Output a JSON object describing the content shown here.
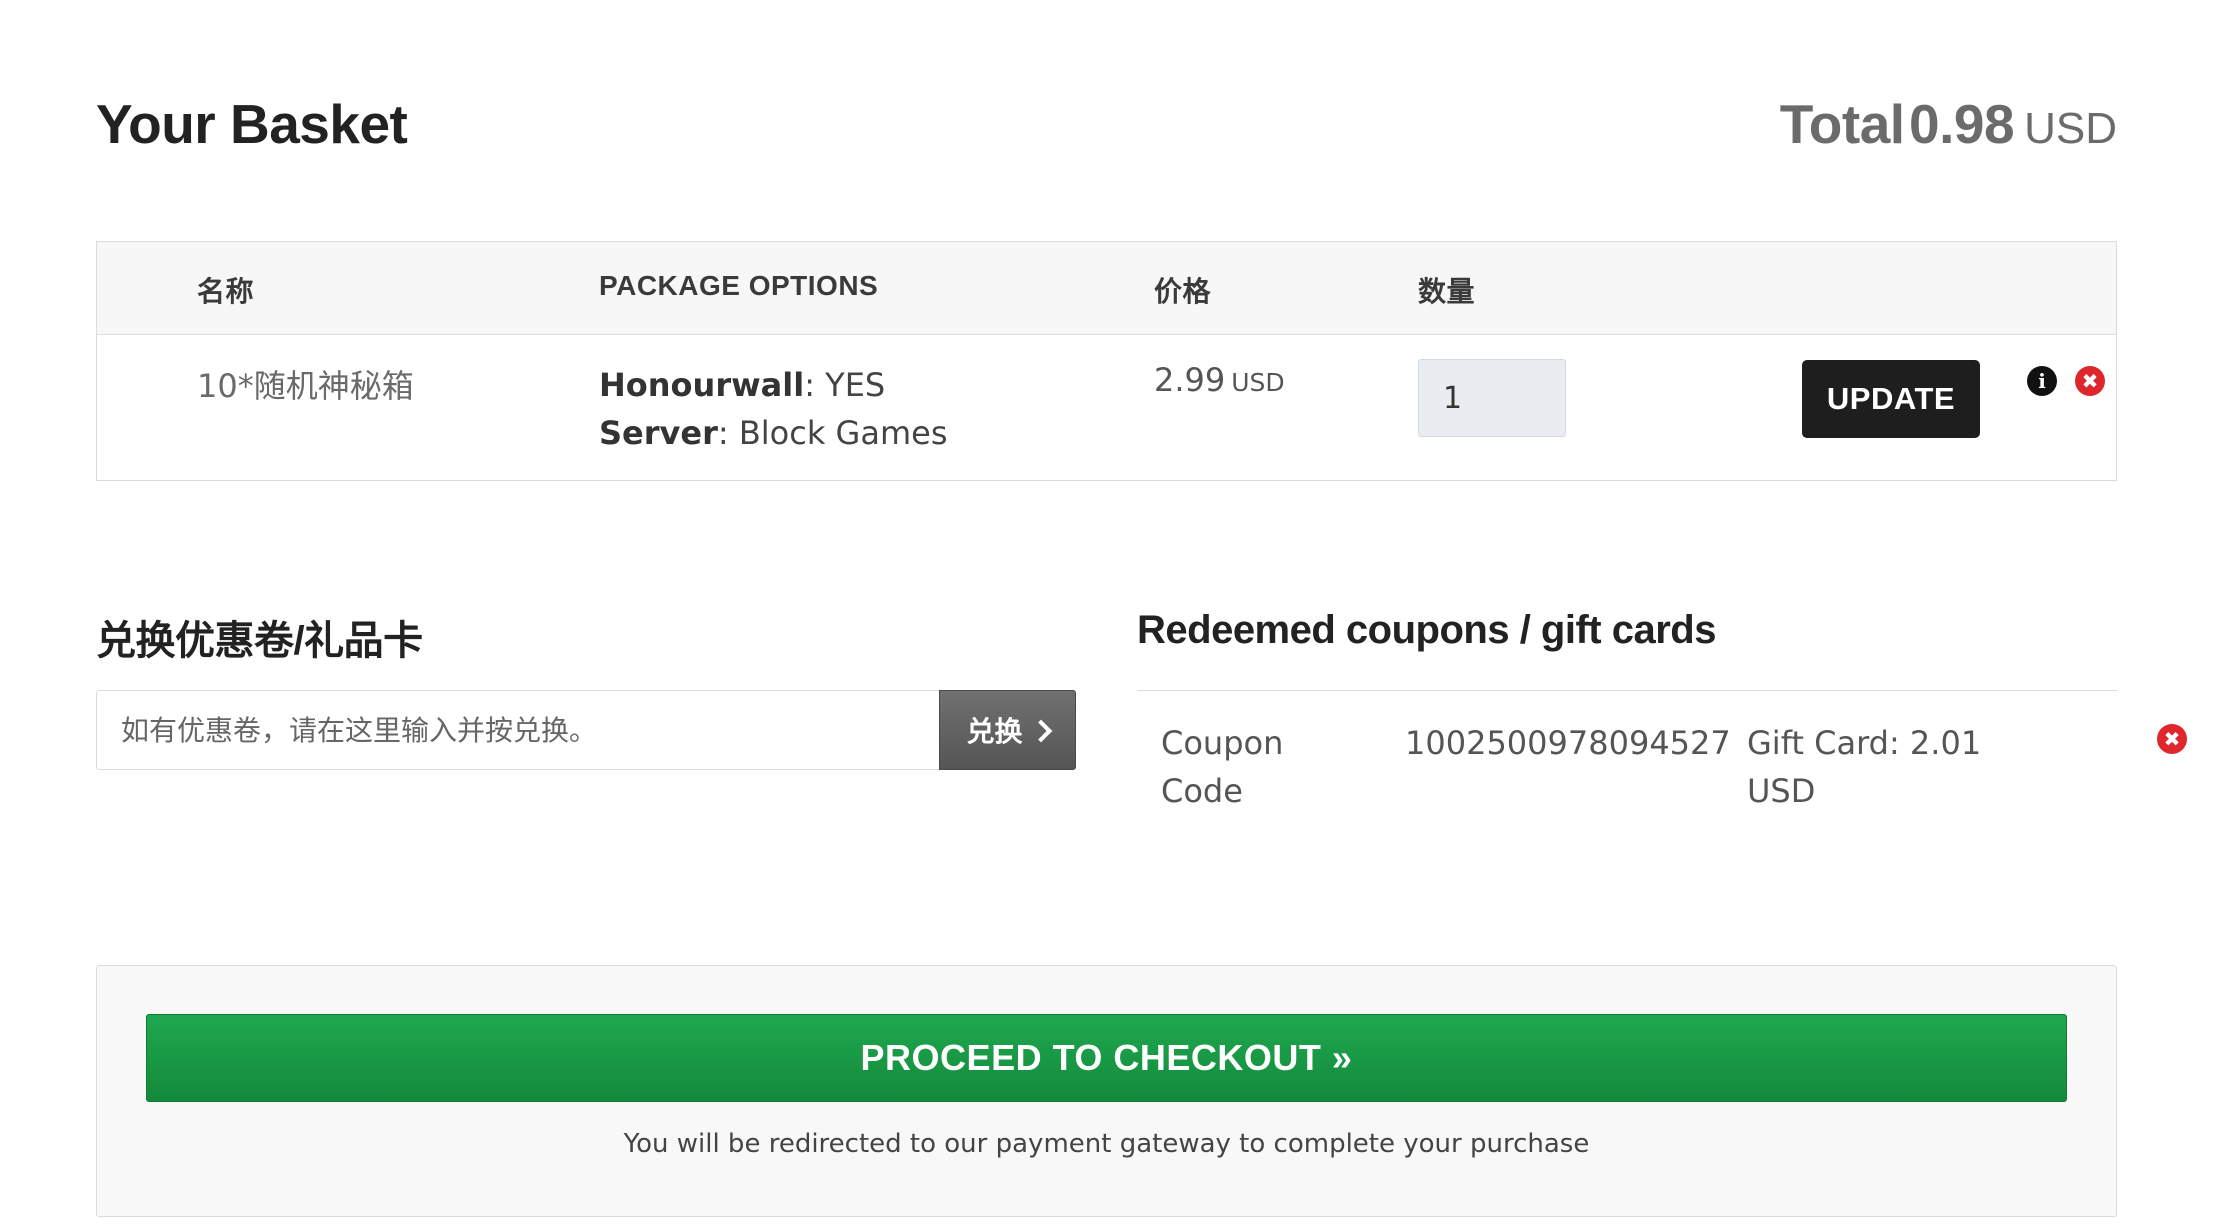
{
  "header": {
    "title": "Your Basket",
    "total_label": "Total",
    "total_amount": "0.98",
    "total_currency": "USD"
  },
  "basket": {
    "columns": {
      "name": "名称",
      "options": "PACKAGE OPTIONS",
      "price": "价格",
      "quantity": "数量"
    },
    "items": [
      {
        "name": "10*随机神秘箱",
        "options": [
          {
            "key": "Honourwall",
            "value": ": YES"
          },
          {
            "key": "Server",
            "value": ": Block Games"
          }
        ],
        "price": "2.99",
        "currency": "USD",
        "quantity": "1",
        "update_label": "UPDATE",
        "info_icon": "i",
        "remove_icon": "✖"
      }
    ]
  },
  "coupon": {
    "title": "兑换优惠卷/礼品卡",
    "placeholder": "如有优惠卷，请在这里输入并按兑换。",
    "redeem_label": "兑换"
  },
  "redeemed": {
    "title": "Redeemed coupons / gift cards",
    "items": [
      {
        "type": "Coupon Code",
        "code": "1002500978094527",
        "value": "Gift Card: 2.01 USD",
        "remove_icon": "✖"
      }
    ]
  },
  "checkout": {
    "button_label": "PROCEED TO CHECKOUT »",
    "note": "You will be redirected to our payment gateway to complete your purchase"
  },
  "colors": {
    "checkout_green": "#1a9a45",
    "remove_red": "#e0262d",
    "update_dark": "#1e1e1e"
  }
}
